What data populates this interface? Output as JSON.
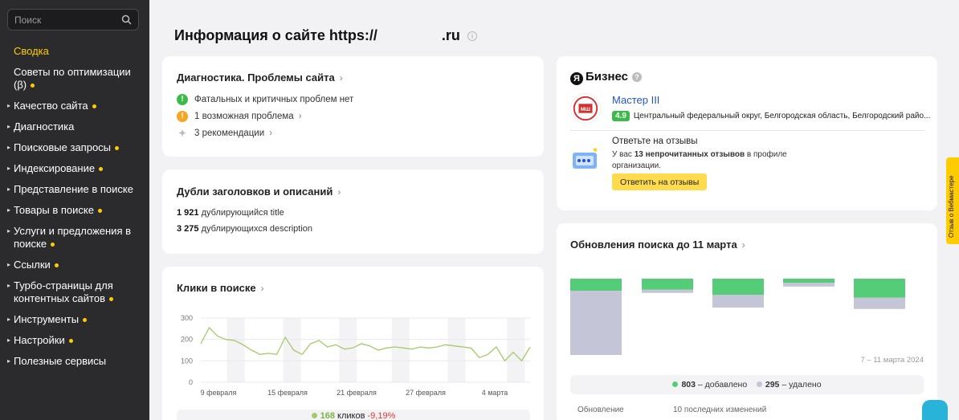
{
  "sidebar": {
    "search_placeholder": "Поиск",
    "items": [
      {
        "label": "Сводка",
        "active": true,
        "dot": false,
        "arrow": false
      },
      {
        "label": "Советы по оптимизации (β)",
        "active": false,
        "dot": true,
        "arrow": false
      },
      {
        "label": "Качество сайта",
        "active": false,
        "dot": true,
        "arrow": true
      },
      {
        "label": "Диагностика",
        "active": false,
        "dot": false,
        "arrow": true
      },
      {
        "label": "Поисковые запросы",
        "active": false,
        "dot": true,
        "arrow": true
      },
      {
        "label": "Индексирование",
        "active": false,
        "dot": true,
        "arrow": true
      },
      {
        "label": "Представление в поиске",
        "active": false,
        "dot": false,
        "arrow": true
      },
      {
        "label": "Товары в поиске",
        "active": false,
        "dot": true,
        "arrow": true
      },
      {
        "label": "Услуги и предложения в поиске",
        "active": false,
        "dot": true,
        "arrow": true
      },
      {
        "label": "Ссылки",
        "active": false,
        "dot": true,
        "arrow": true
      },
      {
        "label": "Турбо-страницы для контентных сайтов",
        "active": false,
        "dot": true,
        "arrow": true
      },
      {
        "label": "Инструменты",
        "active": false,
        "dot": true,
        "arrow": true
      },
      {
        "label": "Настройки",
        "active": false,
        "dot": true,
        "arrow": true
      },
      {
        "label": "Полезные сервисы",
        "active": false,
        "dot": false,
        "arrow": true
      }
    ]
  },
  "page": {
    "title_prefix": "Информация о сайте https://",
    "title_suffix": ".ru"
  },
  "diagnostics": {
    "title": "Диагностика. Проблемы сайта",
    "rows": [
      {
        "icon": "check-icon",
        "text": "Фатальных и критичных проблем нет",
        "color": "#3cba4a"
      },
      {
        "icon": "warning-icon",
        "text": "1 возможная проблема",
        "color": "#f5a623"
      },
      {
        "icon": "sparkle-icon",
        "text": "3 рекомендации",
        "color": "#bbbbbb"
      }
    ]
  },
  "duplicates": {
    "title": "Дубли заголовков и описаний",
    "title_count": "1 921",
    "title_text": "дублирующийся title",
    "desc_count": "3 275",
    "desc_text": "дублирующихся description"
  },
  "clicks": {
    "title": "Клики в поиске",
    "total": "168",
    "total_label": "кликов",
    "change": "-9,19%"
  },
  "business": {
    "brand": "Бизнес",
    "org_name": "Мастер III",
    "rating": "4.9",
    "address": "Центральный федеральный округ, Белгородская область, Белгородский райо...",
    "reviews_title": "Ответьте на отзывы",
    "reviews_text_before": "У вас",
    "reviews_text_bold": "13 непрочитанных отзывов",
    "reviews_text_after": "в профиле организации.",
    "reviews_button": "Ответить на отзывы"
  },
  "updates": {
    "title": "Обновления поиска до 11 марта",
    "date_range": "7 – 11 марта 2024",
    "added_count": "803",
    "added_label": "– добавлено",
    "removed_count": "295",
    "removed_label": "– удалено",
    "col1": "Обновление",
    "col2": "10 последних изменений"
  },
  "feedback_tab": "Отзыв о Вебмастере",
  "colors": {
    "accent": "#ffcc00",
    "added": "#55cc77",
    "removed": "#c5c5d8",
    "line": "#a5c96a",
    "sidebar_bg": "#2b2b2e"
  },
  "chart_data": [
    {
      "type": "line",
      "x": [
        "9 февраля",
        "15 февраля",
        "21 февраля",
        "27 февраля",
        "4 марта"
      ],
      "y_ticks": [
        "0",
        "100",
        "200",
        "300"
      ],
      "ylim": [
        0,
        300
      ],
      "values": [
        180,
        255,
        215,
        200,
        195,
        175,
        150,
        130,
        135,
        130,
        210,
        150,
        130,
        180,
        195,
        165,
        175,
        155,
        160,
        180,
        170,
        150,
        160,
        165,
        160,
        155,
        165,
        160,
        165,
        175,
        170,
        165,
        160,
        115,
        130,
        165,
        100,
        140,
        100,
        165
      ]
    },
    {
      "type": "bar",
      "series": [
        {
          "values": [
            60,
            55,
            80,
            20,
            95
          ]
        },
        {
          "values": [
            200,
            10,
            40,
            12,
            35
          ]
        }
      ]
    }
  ]
}
